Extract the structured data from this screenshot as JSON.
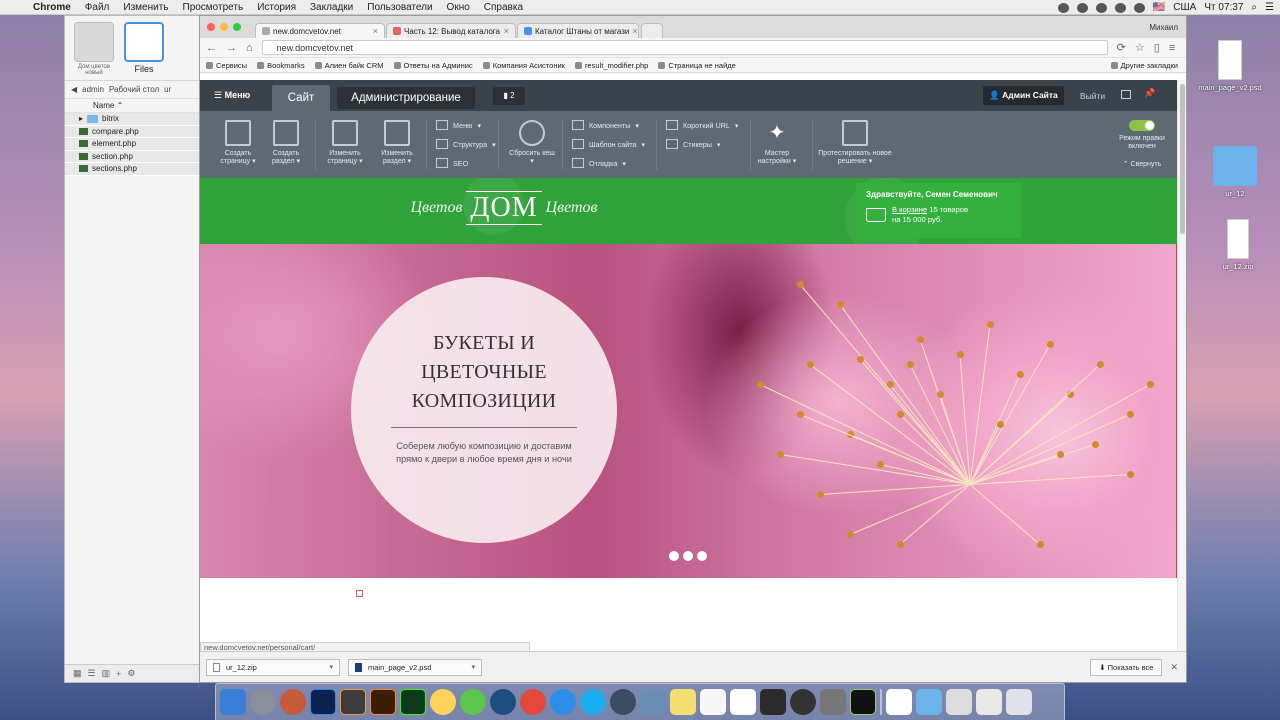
{
  "menubar": {
    "app": "Chrome",
    "items": [
      "Файл",
      "Изменить",
      "Просмотреть",
      "История",
      "Закладки",
      "Пользователи",
      "Окно",
      "Справка"
    ],
    "locale": "США",
    "clock": "Чт 07:37"
  },
  "finder": {
    "items": [
      {
        "label": "Дом цветов новый",
        "icon": "folder-icon"
      },
      {
        "label": "Files",
        "icon": "drive-icon"
      }
    ],
    "path": [
      "admin",
      "Рабочий стол",
      "ur"
    ],
    "column_header": "Name",
    "files": [
      {
        "name": "bitrix",
        "type": "folder"
      },
      {
        "name": "compare.php",
        "type": "file"
      },
      {
        "name": "element.php",
        "type": "file"
      },
      {
        "name": "section.php",
        "type": "file"
      },
      {
        "name": "sections.php",
        "type": "file"
      }
    ]
  },
  "browser": {
    "tabs": [
      {
        "title": "new.domcvetov.net",
        "active": true
      },
      {
        "title": "Часть 12: Вывод каталога",
        "active": false
      },
      {
        "title": "Каталог Штаны от магази",
        "active": false
      }
    ],
    "user": "Михаил",
    "url": "new.domcvetov.net",
    "bookmarks": [
      "Сервисы",
      "Bookmarks",
      "Алиен байк CRM",
      "Ответы на Админис",
      "Компания Асистоник",
      "result_modifier.php",
      "Страница не найде"
    ],
    "other_bookmarks": "Другие закладки",
    "status_url": "new.domcvetov.net/personal/cart/"
  },
  "admin_panel": {
    "menu": "Меню",
    "tab_site": "Сайт",
    "tab_admin": "Администрирование",
    "notifications": "2",
    "admin_user": "Админ Сайта",
    "logout": "Выйти",
    "tools": [
      {
        "label": "Создать страницу",
        "icon": "create-page-icon"
      },
      {
        "label": "Создать раздел",
        "icon": "create-section-icon"
      },
      {
        "label": "Изменить страницу",
        "icon": "edit-page-icon"
      },
      {
        "label": "Изменить раздел",
        "icon": "edit-section-icon"
      },
      {
        "label": "Сбросить кеш",
        "icon": "refresh-cache-icon"
      },
      {
        "label": "Мастер настройки",
        "icon": "wizard-icon"
      },
      {
        "label": "Протестировать новое решение",
        "icon": "test-solution-icon"
      }
    ],
    "menu_links": [
      "Меню",
      "Структура",
      "SEO",
      "Компоненты",
      "Шаблон сайта",
      "Отладка",
      "Короткий URL",
      "Стикеры"
    ],
    "edit_mode": "Режим правки включен",
    "collapse": "Свернуть"
  },
  "site": {
    "logo_main": "ДОМ",
    "logo_side": "Цветов",
    "greeting": "Здравствуйте, Семен Семенович",
    "cart_link": "В корзине",
    "cart_items": "15 товаров",
    "cart_total": "на 15 000 руб.",
    "hero_title": "БУКЕТЫ И ЦВЕТОЧНЫЕ КОМПОЗИЦИИ",
    "hero_text": "Соберем любую композицию и доставим прямо к двери в любое время дня и ночи",
    "slides": 3
  },
  "downloads": {
    "items": [
      "ur_12.zip",
      "main_page_v2.psd"
    ],
    "show_all": "Показать все"
  },
  "desktop": {
    "icons": [
      "main_page_v2.psd",
      "ur_12",
      "ur_12.zip"
    ]
  }
}
